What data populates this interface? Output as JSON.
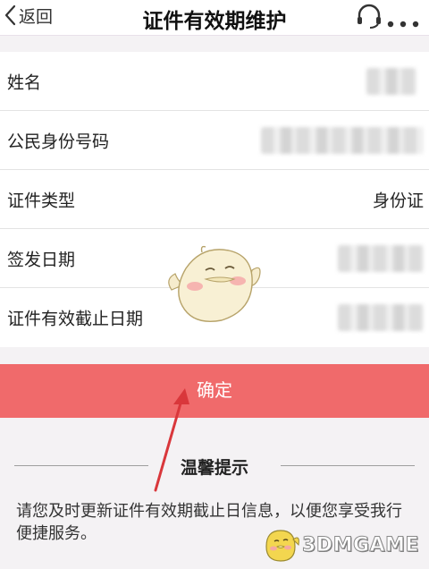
{
  "header": {
    "back_label": "返回",
    "title": "证件有效期维护"
  },
  "form": {
    "rows": [
      {
        "label": "姓名",
        "value": ""
      },
      {
        "label": "公民身份号码",
        "value": ""
      },
      {
        "label": "证件类型",
        "value": "身份证"
      },
      {
        "label": "签发日期",
        "value": ""
      },
      {
        "label": "证件有效截止日期",
        "value": ""
      }
    ]
  },
  "confirm_label": "确定",
  "tips": {
    "title": "温馨提示",
    "body": "请您及时更新证件有效期截止日信息，以便您享受我行便捷服务。"
  },
  "watermark": {
    "text": "3DMGAME"
  },
  "colors": {
    "confirm_bg": "#f06a6b",
    "header_bg": "#ffffff",
    "page_bg": "#f4f2f4",
    "arrow": "#d9373b"
  }
}
